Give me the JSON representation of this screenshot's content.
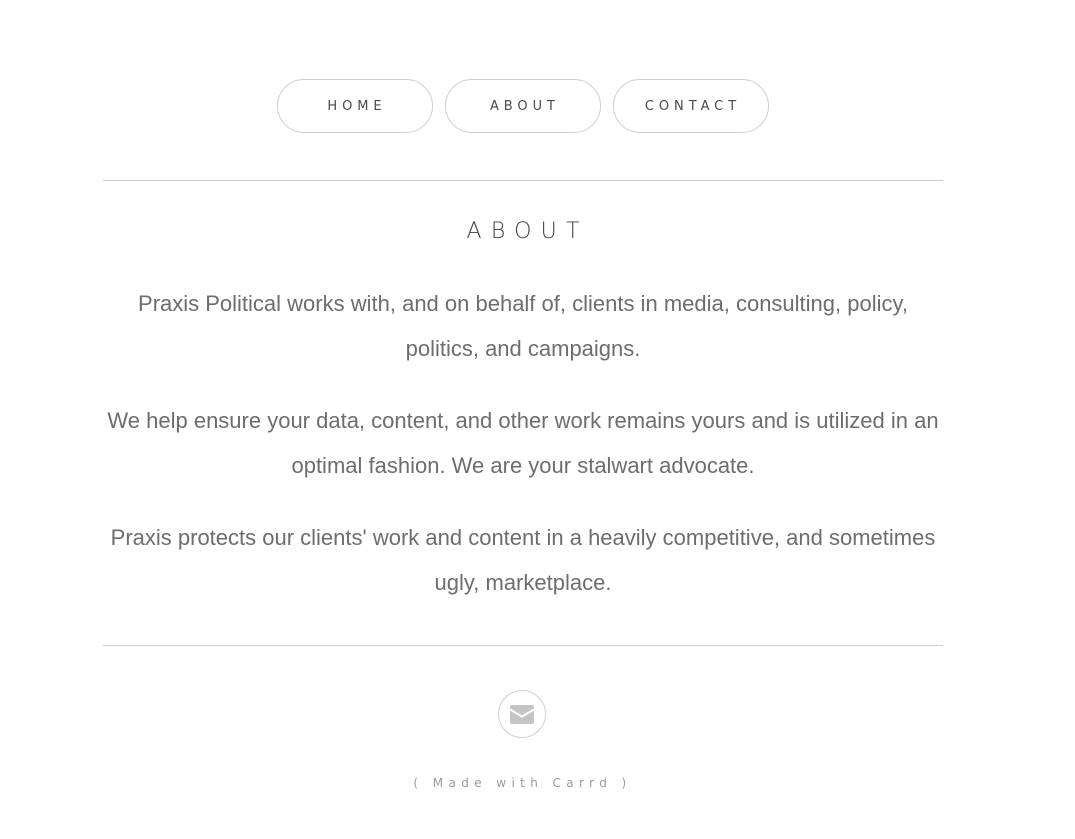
{
  "nav": {
    "items": [
      {
        "label": "HOME"
      },
      {
        "label": "ABOUT"
      },
      {
        "label": "CONTACT"
      }
    ]
  },
  "about": {
    "heading": "ABOUT",
    "paragraphs": [
      "Praxis Political works with, and on behalf of, clients in media, consulting, policy, politics, and campaigns.",
      "We help ensure your data, content, and other work remains yours and is utilized in an optimal fashion. We are your stalwart advocate.",
      "Praxis protects our clients' work and content in a heavily competitive, and sometimes ugly, marketplace."
    ]
  },
  "footer": {
    "icon": "envelope-icon",
    "credit_open": "( ",
    "credit_link": "Made with Carrd",
    "credit_close": " )"
  },
  "colors": {
    "text": "#6d6d6d",
    "border": "#cfcfcf",
    "background": "#ffffff"
  }
}
